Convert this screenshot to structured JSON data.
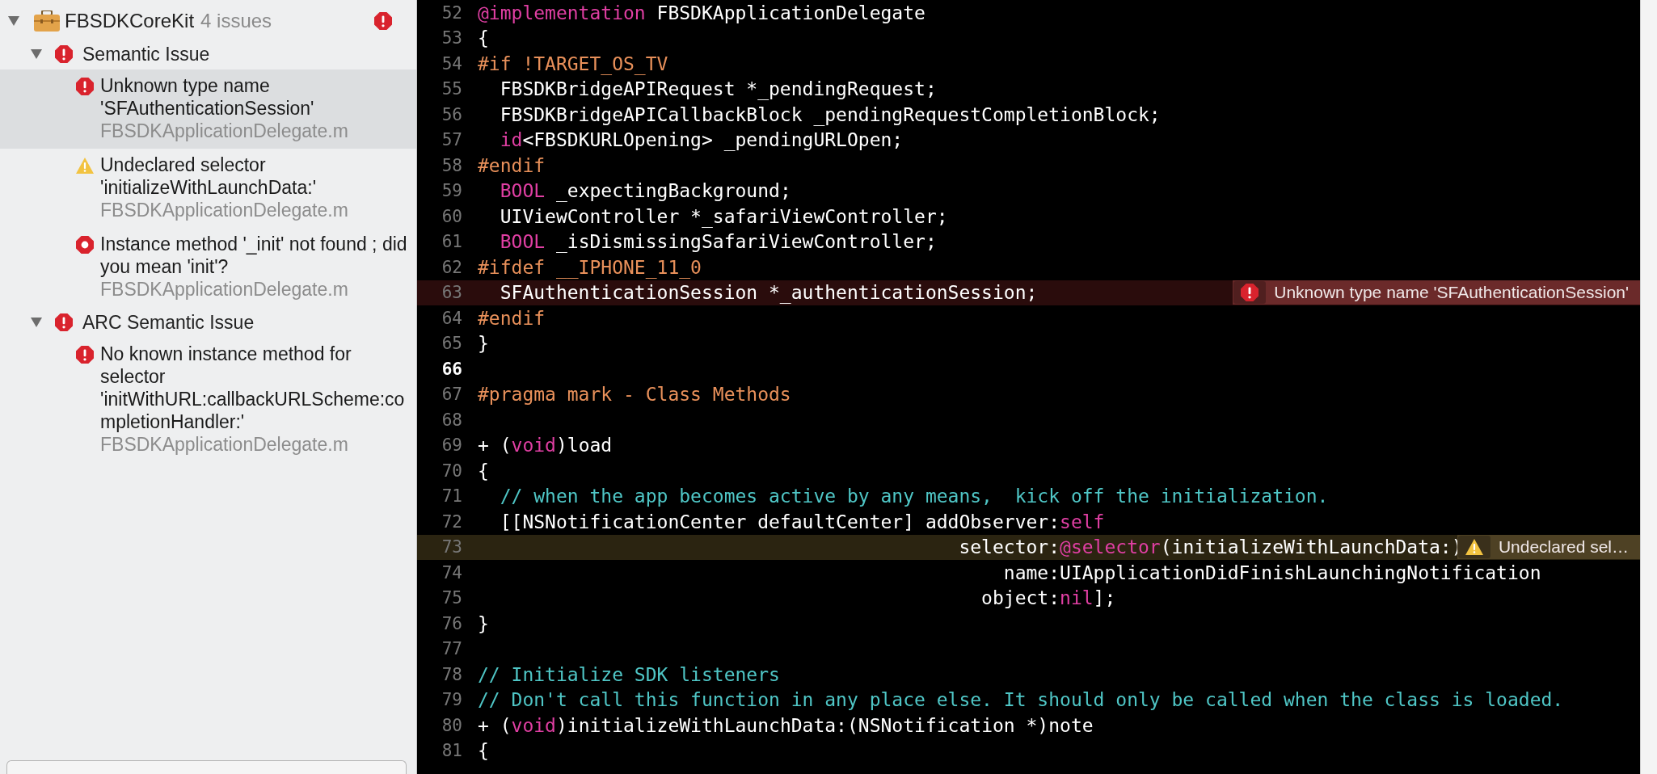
{
  "navigator": {
    "project": {
      "name": "FBSDKCoreKit",
      "count": "4 issues",
      "expanded": true,
      "kind": "error"
    },
    "groups": [
      {
        "title": "Semantic Issue",
        "expanded": true,
        "kind": "error",
        "children": [
          {
            "kind": "error",
            "message": "Unknown type name 'SFAuthenticationSession'",
            "file": "FBSDKApplicationDelegate.m",
            "selected": true
          },
          {
            "kind": "warning",
            "message": "Undeclared selector 'initializeWithLaunchData:'",
            "file": "FBSDKApplicationDelegate.m",
            "selected": false
          },
          {
            "kind": "fixit",
            "message": "Instance method '_init' not found ; did you mean 'init'?",
            "file": "FBSDKApplicationDelegate.m",
            "selected": false
          }
        ]
      },
      {
        "title": "ARC Semantic Issue",
        "expanded": true,
        "kind": "error",
        "children": [
          {
            "kind": "error",
            "message": "No known instance method for selector 'initWithURL:callbackURLScheme:completionHandler:'",
            "file": "FBSDKApplicationDelegate.m",
            "selected": false
          }
        ]
      }
    ]
  },
  "editor": {
    "lines": [
      {
        "number": "52",
        "current": false,
        "segments": [
          {
            "kind": "keyword",
            "text": "@implementation"
          },
          {
            "kind": "plain",
            "text": " FBSDKApplicationDelegate"
          }
        ]
      },
      {
        "number": "53",
        "current": false,
        "segments": [
          {
            "kind": "plain",
            "text": "{"
          }
        ]
      },
      {
        "number": "54",
        "current": false,
        "segments": [
          {
            "kind": "preproc",
            "text": "#if !TARGET_OS_TV"
          }
        ]
      },
      {
        "number": "55",
        "current": false,
        "segments": [
          {
            "kind": "plain",
            "text": "  FBSDKBridgeAPIRequest *_pendingRequest;"
          }
        ]
      },
      {
        "number": "56",
        "current": false,
        "segments": [
          {
            "kind": "plain",
            "text": "  FBSDKBridgeAPICallbackBlock _pendingRequestCompletionBlock;"
          }
        ]
      },
      {
        "number": "57",
        "current": false,
        "segments": [
          {
            "kind": "keyword",
            "text": "  id"
          },
          {
            "kind": "plain",
            "text": "<FBSDKURLOpening> _pendingURLOpen;"
          }
        ]
      },
      {
        "number": "58",
        "current": false,
        "segments": [
          {
            "kind": "preproc",
            "text": "#endif"
          }
        ]
      },
      {
        "number": "59",
        "current": false,
        "segments": [
          {
            "kind": "keyword",
            "text": "  BOOL"
          },
          {
            "kind": "plain",
            "text": " _expectingBackground;"
          }
        ]
      },
      {
        "number": "60",
        "current": false,
        "segments": [
          {
            "kind": "plain",
            "text": "  UIViewController *_safariViewController;"
          }
        ]
      },
      {
        "number": "61",
        "current": false,
        "segments": [
          {
            "kind": "keyword",
            "text": "  BOOL"
          },
          {
            "kind": "plain",
            "text": " _isDismissingSafariViewController;"
          }
        ]
      },
      {
        "number": "62",
        "current": false,
        "segments": [
          {
            "kind": "preproc",
            "text": "#ifdef __IPHONE_11_0"
          }
        ]
      },
      {
        "number": "63",
        "current": false,
        "segments": [
          {
            "kind": "plain",
            "text": "  SFAuthenticationSession *_authenticationSession;"
          }
        ],
        "issue": {
          "kind": "error",
          "message": "Unknown type name 'SFAuthenticationSession'"
        }
      },
      {
        "number": "64",
        "current": false,
        "segments": [
          {
            "kind": "preproc",
            "text": "#endif"
          }
        ]
      },
      {
        "number": "65",
        "current": false,
        "segments": [
          {
            "kind": "plain",
            "text": "}"
          }
        ]
      },
      {
        "number": "66",
        "current": true
      },
      {
        "number": "67",
        "current": false,
        "segments": [
          {
            "kind": "preproc",
            "text": "#pragma mark - Class Methods"
          }
        ]
      },
      {
        "number": "68",
        "current": false
      },
      {
        "number": "69",
        "current": false,
        "segments": [
          {
            "kind": "plain",
            "text": "+ ("
          },
          {
            "kind": "keyword",
            "text": "void"
          },
          {
            "kind": "plain",
            "text": ")load"
          }
        ]
      },
      {
        "number": "70",
        "current": false,
        "segments": [
          {
            "kind": "plain",
            "text": "{"
          }
        ]
      },
      {
        "number": "71",
        "current": false,
        "segments": [
          {
            "kind": "comment",
            "text": "  // when the app becomes active by any means,  kick off the initialization."
          }
        ]
      },
      {
        "number": "72",
        "current": false,
        "segments": [
          {
            "kind": "plain",
            "text": "  [[NSNotificationCenter defaultCenter] addObserver:"
          },
          {
            "kind": "keyword",
            "text": "self"
          }
        ]
      },
      {
        "number": "73",
        "current": false,
        "segments": [
          {
            "kind": "plain",
            "text": "                                           selector:"
          },
          {
            "kind": "keyword",
            "text": "@selector"
          },
          {
            "kind": "plain",
            "text": "(initializeWithLaunchData:)"
          }
        ],
        "issue": {
          "kind": "warning",
          "message": "Undeclared sel…"
        }
      },
      {
        "number": "74",
        "current": false,
        "segments": [
          {
            "kind": "plain",
            "text": "                                               name:UIApplicationDidFinishLaunchingNotification"
          }
        ]
      },
      {
        "number": "75",
        "current": false,
        "segments": [
          {
            "kind": "plain",
            "text": "                                             object:"
          },
          {
            "kind": "keyword",
            "text": "nil"
          },
          {
            "kind": "plain",
            "text": "];"
          }
        ]
      },
      {
        "number": "76",
        "current": false,
        "segments": [
          {
            "kind": "plain",
            "text": "}"
          }
        ]
      },
      {
        "number": "77",
        "current": false
      },
      {
        "number": "78",
        "current": false,
        "segments": [
          {
            "kind": "comment",
            "text": "// Initialize SDK listeners"
          }
        ]
      },
      {
        "number": "79",
        "current": false,
        "segments": [
          {
            "kind": "comment",
            "text": "// Don't call this function in any place else. It should only be called when the class is loaded."
          }
        ]
      },
      {
        "number": "80",
        "current": false,
        "segments": [
          {
            "kind": "plain",
            "text": "+ ("
          },
          {
            "kind": "keyword",
            "text": "void"
          },
          {
            "kind": "plain",
            "text": ")initializeWithLaunchData:(NSNotification *)note"
          }
        ]
      },
      {
        "number": "81",
        "current": false,
        "segments": [
          {
            "kind": "plain",
            "text": "{"
          }
        ]
      }
    ]
  }
}
